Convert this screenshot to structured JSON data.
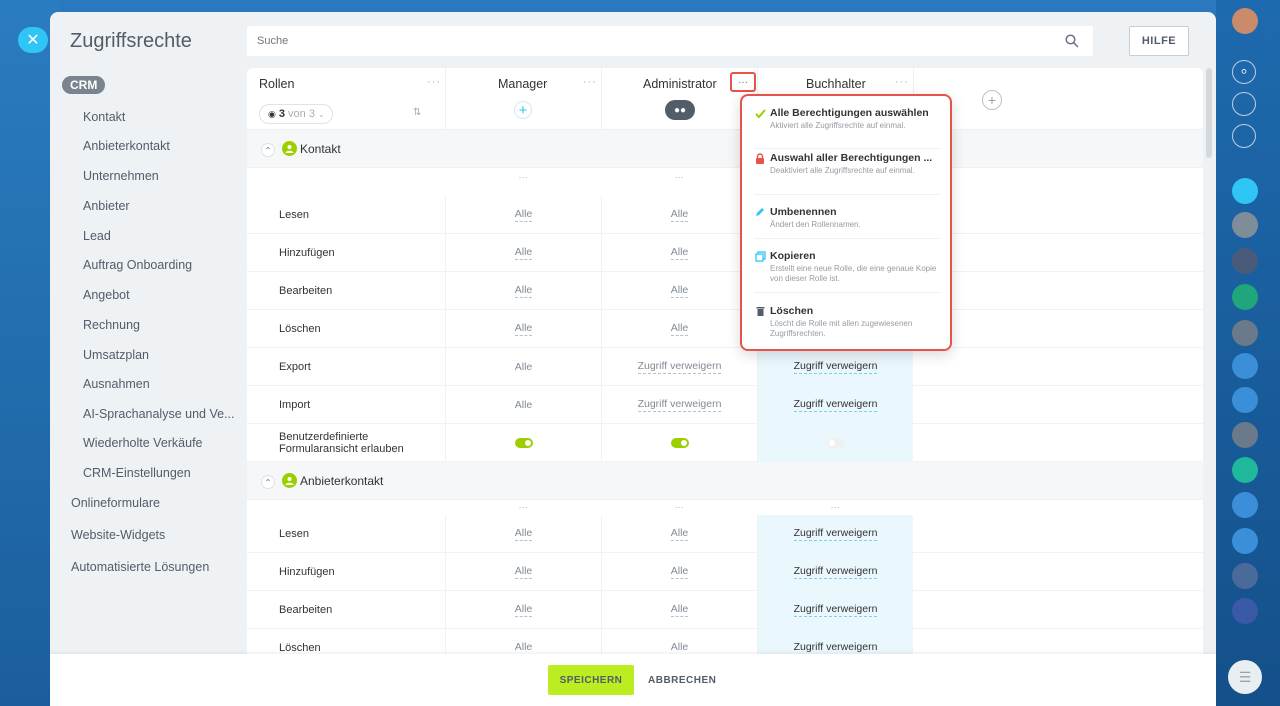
{
  "panel": {
    "title": "Zugriffsrechte"
  },
  "search": {
    "placeholder": "Suche"
  },
  "help_button": "HILFE",
  "sidebar": {
    "crm_badge": "CRM",
    "sub_items": [
      "Kontakt",
      "Anbieterkontakt",
      "Unternehmen",
      "Anbieter",
      "Lead",
      "Auftrag Onboarding",
      "Angebot",
      "Rechnung",
      "Umsatzplan",
      "Ausnahmen",
      "AI-Sprachanalyse und Ve...",
      "Wiederholte Verkäufe",
      "CRM-Einstellungen"
    ],
    "top_items": [
      "Onlineformulare",
      "Website-Widgets",
      "Automatisierte Lösungen"
    ]
  },
  "header": {
    "roles_label": "Rollen",
    "role_count": "3",
    "role_count_suffix": "von 3",
    "dots": "···",
    "columns": [
      "Manager",
      "Administrator",
      "Buchhalter"
    ]
  },
  "sections": [
    {
      "title": "Kontakt",
      "rows": [
        {
          "label": "Lesen",
          "values": [
            "Alle",
            "Alle",
            ""
          ]
        },
        {
          "label": "Hinzufügen",
          "values": [
            "Alle",
            "Alle",
            ""
          ]
        },
        {
          "label": "Bearbeiten",
          "values": [
            "Alle",
            "Alle",
            ""
          ]
        },
        {
          "label": "Löschen",
          "values": [
            "Alle",
            "Alle",
            ""
          ]
        },
        {
          "label": "Export",
          "values": [
            "Alle",
            "Zugriff verweigern",
            "Zugriff verweigern"
          ]
        },
        {
          "label": "Import",
          "values": [
            "Alle",
            "Zugriff verweigern",
            "Zugriff verweigern"
          ]
        },
        {
          "label": "Benutzerdefinierte Formularansicht erlauben",
          "toggles": [
            true,
            true,
            false
          ]
        }
      ]
    },
    {
      "title": "Anbieterkontakt",
      "rows": [
        {
          "label": "Lesen",
          "values": [
            "Alle",
            "Alle",
            "Zugriff verweigern"
          ]
        },
        {
          "label": "Hinzufügen",
          "values": [
            "Alle",
            "Alle",
            "Zugriff verweigern"
          ]
        },
        {
          "label": "Bearbeiten",
          "values": [
            "Alle",
            "Alle",
            "Zugriff verweigern"
          ]
        },
        {
          "label": "Löschen",
          "values": [
            "Alle",
            "Alle",
            "Zugriff verweigern"
          ]
        }
      ]
    }
  ],
  "popup": {
    "items": [
      {
        "title": "Alle Berechtigungen auswählen",
        "desc": "Aktiviert alle Zugriffsrechte auf einmal.",
        "icon": "check-icon",
        "color": "#9dcf00"
      },
      {
        "title": "Auswahl aller Berechtigungen ...",
        "desc": "Deaktiviert alle Zugriffsrechte auf einmal.",
        "icon": "lock-icon",
        "color": "#e5534b"
      },
      {
        "title": "Umbenennen",
        "desc": "Ändert den Rollennamen.",
        "icon": "pencil-icon",
        "color": "#2fc6f6"
      },
      {
        "title": "Kopieren",
        "desc": "Erstellt eine neue Rolle, die eine genaue Kopie von dieser Rolle ist.",
        "icon": "copy-icon",
        "color": "#2fc6f6"
      },
      {
        "title": "Löschen",
        "desc": "Löscht die Rolle mit allen zugewiesenen Zugriffsrechten.",
        "icon": "trash-icon",
        "color": "#535c69"
      }
    ]
  },
  "footer": {
    "save": "SPEICHERN",
    "cancel": "ABBRECHEN"
  },
  "colors": {
    "accent": "#2fc6f6",
    "save": "#bbed21",
    "highlight": "#e5534b",
    "toggle_on": "#9dcf00"
  }
}
